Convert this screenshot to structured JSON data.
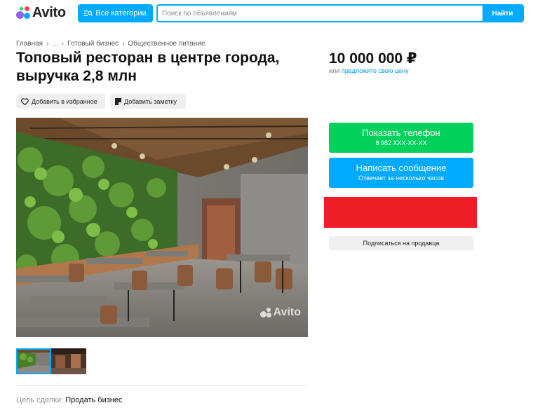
{
  "header": {
    "logo_text": "Avito",
    "categories_label": "Все категории",
    "search_placeholder": "Поиск по объявлениям",
    "search_button": "Найти"
  },
  "breadcrumb": [
    "Главная",
    "...",
    "Готовый бизнес",
    "Общественное питание"
  ],
  "listing": {
    "title": "Топовый ресторан в центре города, выручка 2,8 млн",
    "price": "10 000 000 ₽",
    "price_sub_prefix": "или",
    "price_sub_link": "предложите свою цену",
    "favorite_label": "Добавить в избранное",
    "note_label": "Добавить заметку",
    "watermark": "Avito",
    "deal_label": "Цель сделки:",
    "deal_value": "Продать бизнес"
  },
  "actions": {
    "phone_label": "Показать телефон",
    "phone_number": "8 982 XXX-XX-XX",
    "message_label": "Написать сообщение",
    "message_sub": "Отвечает за несколько часов",
    "subscribe_label": "Подписаться на продавца"
  },
  "colors": {
    "accent": "#00aaff",
    "green": "#02d15c",
    "red_block": "#ee1d26"
  },
  "icons": [
    "search-list-icon",
    "heart-icon",
    "note-icon",
    "avito-logo-icon"
  ]
}
